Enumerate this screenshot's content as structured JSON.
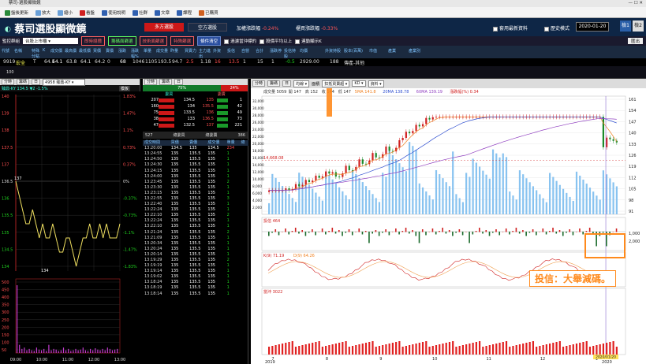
{
  "window_title": "蔡司-選股顯微鏡",
  "toolbar": [
    "盤後更新",
    "放大",
    "縮小",
    "看盤",
    "使用說明",
    "社群",
    "文章",
    "課程",
    "已購買"
  ],
  "brand": {
    "name": "蔡司選股顯微鏡",
    "tab_active": "多方選股",
    "tab2": "空方選股",
    "warn1_label": "加權漲跌幅",
    "warn1_val": "-0.24%",
    "warn2_label": "櫃買漲跌幅",
    "warn2_val": "-0.33%",
    "chk_a": "套用最新資料",
    "chk_b": "歷史模式",
    "date": "2020-01-20",
    "view1": "檢1",
    "view2": "檢2"
  },
  "filter": {
    "label": "監控群組",
    "select": "台股上市櫃",
    "b1": "即時總攬",
    "b2": "籌碼面篩選",
    "b3": "技術面篩選",
    "b4": "特殊篩選",
    "b5": "條件清空",
    "c1": "過濾當沖標的",
    "c2": "股價平均以上",
    "c3": "連動顯示K",
    "out": "匯出"
  },
  "quote_headers": [
    "代號",
    "名稱",
    "特殊分點",
    "K",
    "成交價",
    "最高價",
    "最低價",
    "買價",
    "賣價",
    "漲跌",
    "漲跌幅%",
    "單量",
    "成交量",
    "昨量",
    "買賣力",
    "主力進出",
    "外資",
    "投信",
    "自營",
    "合計",
    "漲跌停",
    "投信持股",
    "均價",
    "外資持股",
    "股本(百萬)",
    "市值",
    "產業",
    "產業別"
  ],
  "quote_row": [
    "9919",
    "宏全",
    "T",
    "64.1",
    "64.1",
    "63.8",
    "64.1",
    "64.2",
    "0",
    "68",
    "1046",
    "1105",
    "193.5",
    "94.7",
    "2.5",
    "1.18",
    "16",
    "13.5",
    "1",
    "15",
    "1",
    "-0.5",
    "2929.00",
    "188",
    "傳產-其他"
  ],
  "sub_code": "100",
  "left_panel": {
    "tabs": [
      "分時",
      "籌碼",
      "日"
    ],
    "stock": "4958 臻鼎-KY",
    "title": "臻鼎-KY 134.5 ▼2 -1.5%",
    "tag": "模板",
    "price_labels": [
      "140",
      "139",
      "138",
      "137.5",
      "137",
      "136.5",
      "136",
      "135.5",
      "135",
      "134.5",
      "134"
    ],
    "pct_labels": [
      "1.83%",
      "1.47%",
      "1.1%",
      "0.73%",
      "0.37%",
      "0%",
      "-0.37%",
      "-0.73%",
      "-1.1%",
      "-1.47%",
      "-1.83%"
    ],
    "hi_marker": "137",
    "lo_marker": "134",
    "vol_labels": [
      "500",
      "450",
      "400",
      "350",
      "300",
      "250",
      "200",
      "150",
      "100",
      "50"
    ],
    "times": [
      "09:00",
      "10:00",
      "11:00",
      "12:00",
      "13:00"
    ]
  },
  "mid_panel": {
    "tabs": [
      "分時",
      "籌碼",
      "日"
    ],
    "pct_buy": "75%",
    "pct_sell": "24%",
    "buy_hdr": "委買",
    "sell_hdr": "委賣",
    "book": [
      [
        "207",
        "134.5",
        "135",
        "1"
      ],
      [
        "160",
        "134",
        "135.5",
        "42"
      ],
      [
        "75",
        "133.5",
        "136",
        "49"
      ],
      [
        "38",
        "133",
        "136.5",
        "73"
      ],
      [
        "47",
        "132.5",
        "137",
        "221"
      ]
    ],
    "tot_buy": "527",
    "tot_mid": "總委買",
    "tot_sell_lbl": "總委賣",
    "tot_sell": "386",
    "tick_hdr": [
      "成交時間",
      "買價",
      "賣價",
      "成交價",
      "單量",
      "總"
    ],
    "ticks": [
      [
        "13:20:00",
        "134.5",
        "135",
        "134.5",
        "234"
      ],
      [
        "13:24:55",
        "135",
        "135.5",
        "135",
        "1"
      ],
      [
        "13:24:50",
        "135",
        "135.5",
        "135",
        "1"
      ],
      [
        "13:24:30",
        "135",
        "135.5",
        "135",
        "1"
      ],
      [
        "13:24:15",
        "135",
        "135.5",
        "135",
        "1"
      ],
      [
        "13:24:00",
        "135",
        "135.5",
        "135",
        "1"
      ],
      [
        "13:23:45",
        "135",
        "135.5",
        "135",
        "2"
      ],
      [
        "13:23:30",
        "135",
        "135.5",
        "135",
        "1"
      ],
      [
        "13:23:15",
        "135",
        "135.5",
        "135",
        "1"
      ],
      [
        "13:22:55",
        "135",
        "135.5",
        "135",
        "3"
      ],
      [
        "13:22:40",
        "135",
        "135.5",
        "135",
        "1"
      ],
      [
        "13:22:24",
        "135",
        "135.5",
        "135",
        "1"
      ],
      [
        "13:22:10",
        "135",
        "135.5",
        "135",
        "2"
      ],
      [
        "13:22:24",
        "135",
        "135.5",
        "135",
        "1"
      ],
      [
        "13:22:10",
        "135",
        "135.5",
        "135",
        "1"
      ],
      [
        "13:21:24",
        "135",
        "135.5",
        "135",
        "2"
      ],
      [
        "13:21:09",
        "135",
        "135.5",
        "135",
        "1"
      ],
      [
        "13:20:34",
        "135",
        "135.5",
        "135",
        "1"
      ],
      [
        "13:20:24",
        "135",
        "135.5",
        "135",
        "1"
      ],
      [
        "13:20:14",
        "135",
        "135.5",
        "135",
        "1"
      ],
      [
        "13:19:29",
        "135",
        "135.5",
        "135",
        "2"
      ],
      [
        "13:19:19",
        "135",
        "135.5",
        "135",
        "1"
      ],
      [
        "13:19:14",
        "135",
        "135.5",
        "135",
        "1"
      ],
      [
        "13:19:02",
        "135",
        "135.5",
        "135",
        "1"
      ],
      [
        "13:18:24",
        "135",
        "135.5",
        "135",
        "1"
      ],
      [
        "13:18:19",
        "135",
        "135.5",
        "135",
        "1"
      ],
      [
        "13:18:14",
        "135",
        "135.5",
        "135",
        "1"
      ]
    ]
  },
  "right_panel": {
    "tabs": [
      "分時",
      "籌碼",
      "日"
    ],
    "sel1": "均線",
    "sel1b": "面積",
    "sel2": "扣抵買賣超",
    "sel3": "KD",
    "sel4": "資料",
    "legend": [
      "成交量 5059",
      "開 147",
      "高 152",
      "收 144",
      "低 147",
      "5MA 141.8",
      "20MA 138.78",
      "60MA 139.19",
      "漲跌幅(%) 0.34"
    ],
    "price_scale": [
      "161",
      "154",
      "147",
      "140",
      "133",
      "126",
      "119",
      "112",
      "105",
      "98",
      "91"
    ],
    "vol_scale": [
      "32,000",
      "30,000",
      "28,000",
      "26,000",
      "24,000",
      "22,000",
      "20,000",
      "18,000",
      "16,000",
      "14,000",
      "12,000",
      "10,000",
      "8,000",
      "6,000",
      "4,000",
      "2,000"
    ],
    "ref_vol": "14,668.08",
    "sub1": "投信 464",
    "sub1_scale": [
      "1,000",
      "2,000"
    ],
    "sub2": "K(9) 71.19",
    "sub2b": "D(9) 64.26",
    "sub3": "當沖 3022",
    "months": [
      "7",
      "8",
      "9",
      "10",
      "11",
      "12",
      "1"
    ],
    "years": [
      "2019",
      "2020"
    ],
    "date_marker": "2020/01/20",
    "annotation": "投信：大舉減碼。"
  },
  "colors": {
    "up": "#ff2e2e",
    "down": "#1fd01f",
    "accent": "#ff8a1c",
    "brand": "#0e2646"
  }
}
